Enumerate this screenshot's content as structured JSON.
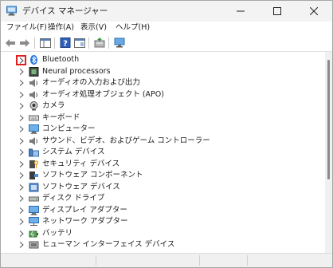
{
  "window": {
    "title": "デバイス マネージャー"
  },
  "menu": [
    {
      "label": "ファイル(F)",
      "name": "menu-file"
    },
    {
      "label": "操作(A)",
      "name": "menu-action"
    },
    {
      "label": "表示(V)",
      "name": "menu-view"
    },
    {
      "label": "ヘルプ(H)",
      "name": "menu-help"
    }
  ],
  "toolbar": [
    {
      "name": "back-button",
      "icon": "back-arrow-icon"
    },
    {
      "name": "forward-button",
      "icon": "forward-arrow-icon"
    },
    {
      "name": "show-hide-console-tree-button",
      "icon": "console-tree-icon"
    },
    {
      "name": "help-button",
      "icon": "help-icon"
    },
    {
      "name": "properties-button",
      "icon": "properties-icon"
    },
    {
      "name": "update-driver-button",
      "icon": "update-driver-icon"
    },
    {
      "name": "scan-hardware-button",
      "icon": "monitor-scan-icon"
    }
  ],
  "tree": [
    {
      "label": "Bluetooth",
      "icon": "bluetooth-icon",
      "selected_chevron": true
    },
    {
      "label": "Neural processors",
      "icon": "processor-icon"
    },
    {
      "label": "オーディオの入力および出力",
      "icon": "speaker-icon"
    },
    {
      "label": "オーディオ処理オブジェクト (APO)",
      "icon": "speaker-icon"
    },
    {
      "label": "カメラ",
      "icon": "camera-icon"
    },
    {
      "label": "キーボード",
      "icon": "keyboard-icon"
    },
    {
      "label": "コンピューター",
      "icon": "computer-icon"
    },
    {
      "label": "サウンド、ビデオ、およびゲーム コントローラー",
      "icon": "speaker-icon"
    },
    {
      "label": "システム デバイス",
      "icon": "system-devices-icon"
    },
    {
      "label": "セキュリティ デバイス",
      "icon": "security-device-icon"
    },
    {
      "label": "ソフトウェア コンポーネント",
      "icon": "software-component-icon"
    },
    {
      "label": "ソフトウェア デバイス",
      "icon": "software-device-icon"
    },
    {
      "label": "ディスク ドライブ",
      "icon": "disk-drive-icon"
    },
    {
      "label": "ディスプレイ アダプター",
      "icon": "display-adapter-icon"
    },
    {
      "label": "ネットワーク アダプター",
      "icon": "network-adapter-icon"
    },
    {
      "label": "バッテリ",
      "icon": "battery-icon"
    },
    {
      "label": "ヒューマン インターフェイス デバイス",
      "icon": "hid-icon"
    }
  ],
  "colors": {
    "highlight_box": "#e02020",
    "titlebar_bg": "#f3f3f3",
    "accent_blue": "#1e73d8"
  }
}
